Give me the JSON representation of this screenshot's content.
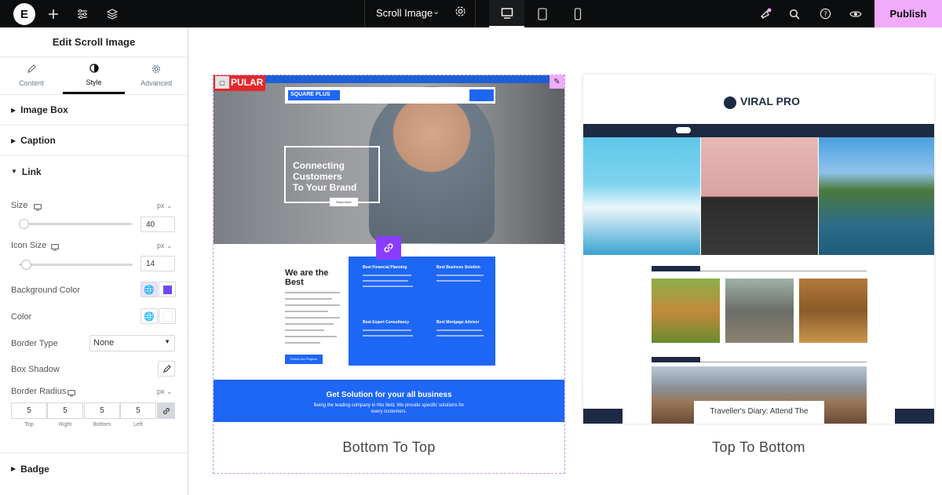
{
  "topbar": {
    "logo": "E",
    "document_title": "Scroll Image",
    "publish_label": "Publish",
    "colors": {
      "bar": "#0c0d0e",
      "publish": "#f0abfc"
    }
  },
  "panel": {
    "title": "Edit Scroll Image",
    "tabs": [
      {
        "label": "Content",
        "icon": "pencil-icon"
      },
      {
        "label": "Style",
        "icon": "half-circle-icon"
      },
      {
        "label": "Advanced",
        "icon": "gear-icon"
      }
    ],
    "sections": {
      "image_box": "Image Box",
      "caption": "Caption",
      "link": "Link",
      "badge": "Badge"
    },
    "controls": {
      "size_label": "Size",
      "size_unit": "px",
      "size_value": "40",
      "icon_size_label": "Icon Size",
      "icon_size_unit": "px",
      "icon_size_value": "14",
      "background_color_label": "Background Color",
      "background_color": "#6d4bf2",
      "color_label": "Color",
      "color_value": "#ffffff",
      "border_type_label": "Border Type",
      "border_type_value": "None",
      "box_shadow_label": "Box Shadow",
      "border_radius_label": "Border Radius",
      "border_radius_unit": "px",
      "radius": [
        {
          "value": "5",
          "label": "Top"
        },
        {
          "value": "5",
          "label": "Right"
        },
        {
          "value": "5",
          "label": "Bottom"
        },
        {
          "value": "5",
          "label": "Left"
        }
      ]
    }
  },
  "preview_left": {
    "badge": "PULAR",
    "logo_text": "SQUARE PLUS",
    "hero_heading_1": "Connecting",
    "hero_heading_2": "Customers",
    "hero_heading_3": "To Your Brand",
    "read_more": "Read More",
    "best_heading": "We are the Best",
    "check_button": "Check Our Projects",
    "services": [
      "Best Financial Planning",
      "Best Business Solution",
      "Best Expert Consultancy",
      "Best Mortgage Advisor"
    ],
    "band_title": "Get Solution for your all business",
    "band_subtitle": "Being the leading company in this field, We provide specific solutions for every customers.",
    "caption": "Bottom To Top"
  },
  "preview_right": {
    "logo_text": "VIRAL PRO",
    "story_title": "Traveller's Diary: Attend The",
    "caption": "Top To Bottom"
  }
}
